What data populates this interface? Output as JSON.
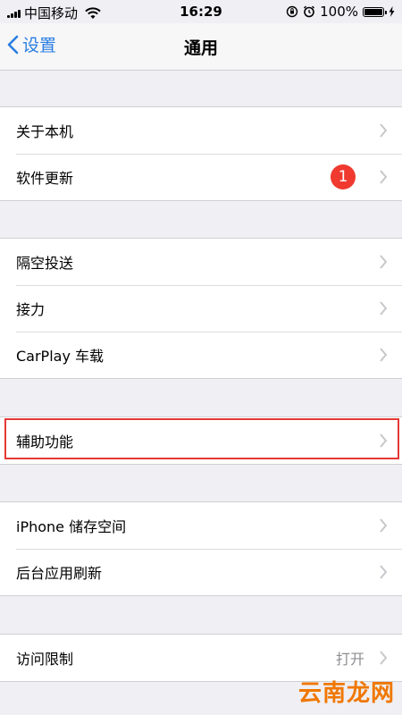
{
  "status_bar": {
    "carrier": "中国移动",
    "time": "16:29",
    "battery": "100%",
    "battery_level": 1.0,
    "icons": [
      "signal-icon",
      "wifi-icon",
      "orientation-lock-icon",
      "alarm-icon",
      "battery-icon",
      "charging-icon"
    ]
  },
  "nav": {
    "back_label": "设置",
    "title": "通用"
  },
  "groups": [
    {
      "items": [
        {
          "label": "关于本机"
        },
        {
          "label": "软件更新",
          "badge": "1"
        }
      ]
    },
    {
      "items": [
        {
          "label": "隔空投送"
        },
        {
          "label": "接力"
        },
        {
          "label": "CarPlay 车载"
        }
      ]
    },
    {
      "items": [
        {
          "label": "辅助功能",
          "highlighted": true
        }
      ]
    },
    {
      "items": [
        {
          "label": "iPhone 储存空间"
        },
        {
          "label": "后台应用刷新"
        }
      ]
    },
    {
      "items": [
        {
          "label": "访问限制",
          "value": "打开"
        }
      ]
    }
  ],
  "watermark": "云南龙网",
  "colors": {
    "accent": "#2a7de1",
    "badge": "#f03a2f",
    "highlight": "#e53935",
    "watermark": "#f07700",
    "background": "#efeff4"
  }
}
